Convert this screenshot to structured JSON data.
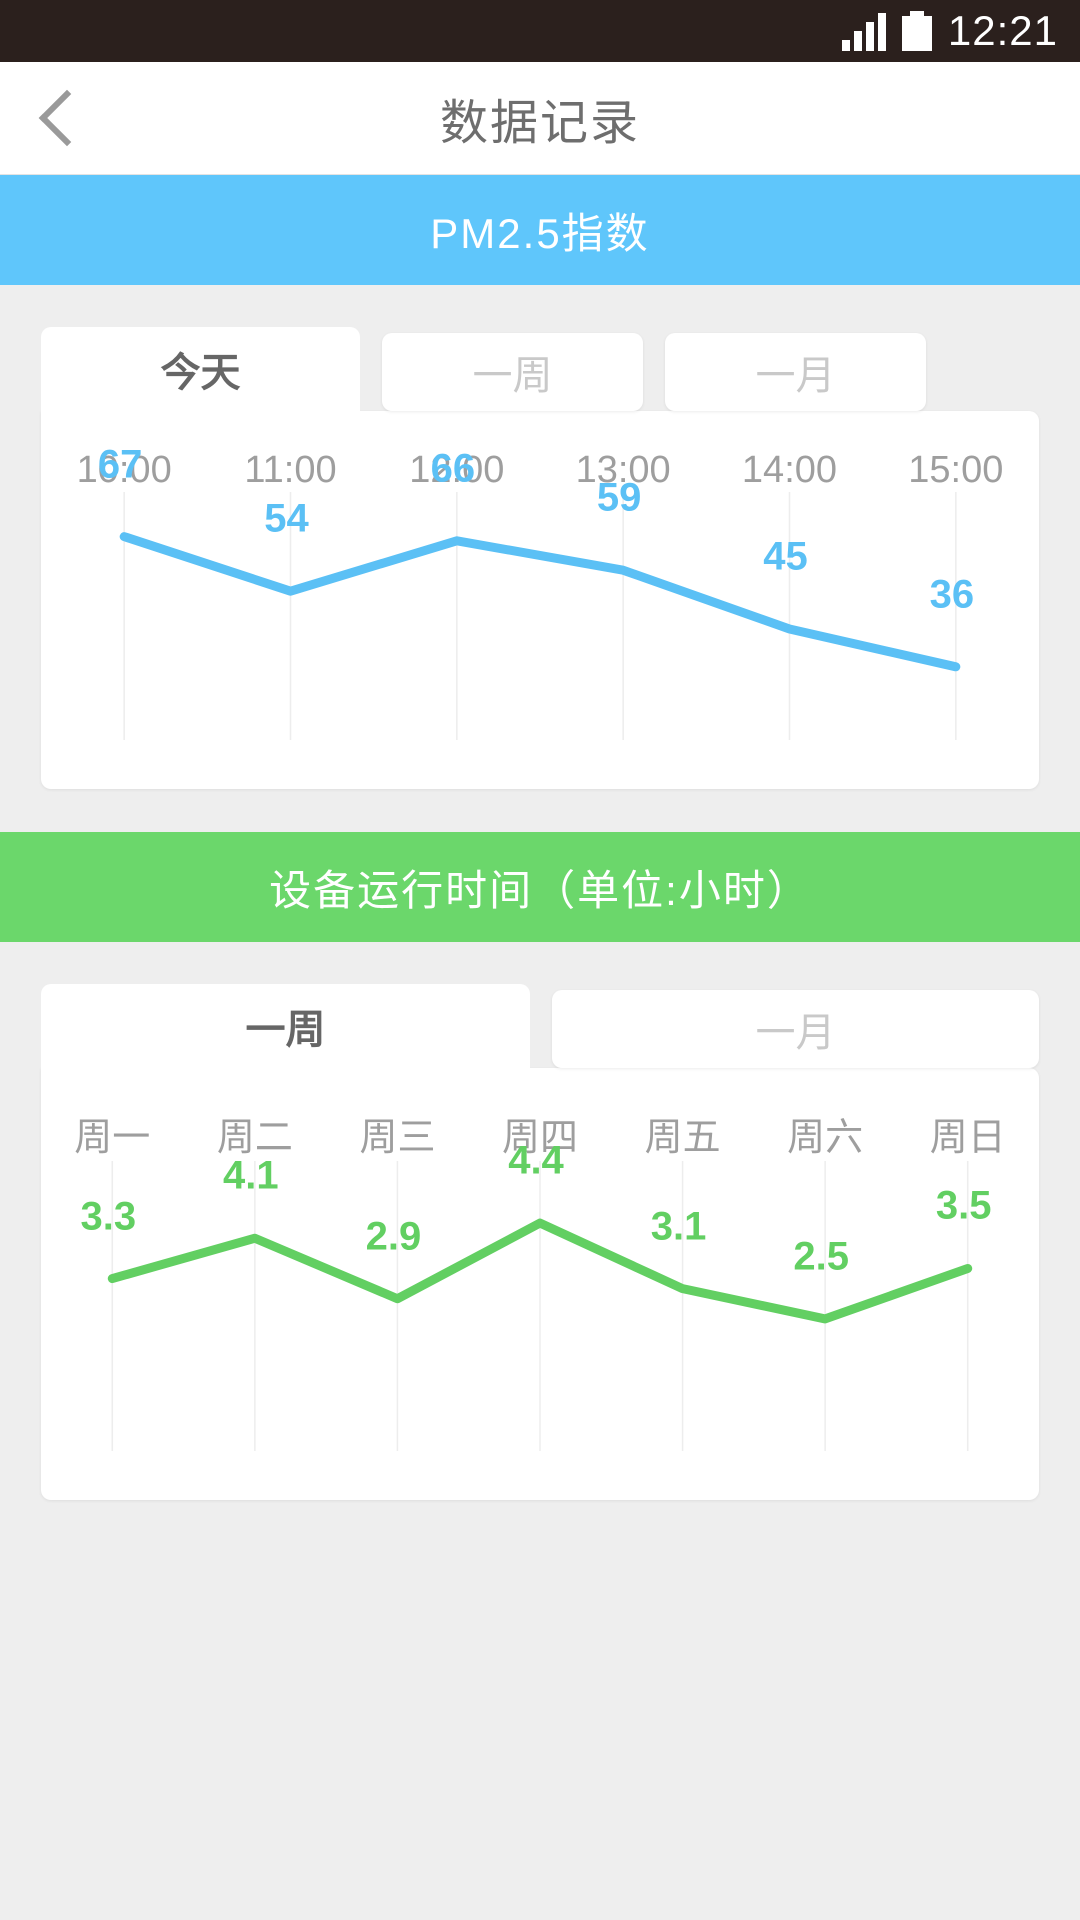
{
  "statusbar": {
    "time": "12:21",
    "signal_icon": "signal-bars-icon",
    "battery_icon": "battery-full-icon"
  },
  "titlebar": {
    "back_icon": "back-chevron-icon",
    "title": "数据记录"
  },
  "sections": [
    {
      "band_label": "PM2.5指数",
      "band_color": "#5fc6fb",
      "tabs": [
        {
          "label": "今天",
          "active": true
        },
        {
          "label": "一周",
          "active": false
        },
        {
          "label": "一月",
          "active": false
        }
      ]
    },
    {
      "band_label": "设备运行时间（单位:小时）",
      "band_color": "#6bd76b",
      "tabs": [
        {
          "label": "一周",
          "active": true
        },
        {
          "label": "一月",
          "active": false
        }
      ]
    }
  ],
  "chart_data": [
    {
      "type": "line",
      "title": "PM2.5指数",
      "xlabel": "",
      "ylabel": "",
      "grid": true,
      "legend": "none",
      "series_color": "#5bc0f5",
      "categories": [
        "10:00",
        "11:00",
        "12:00",
        "13:00",
        "14:00",
        "15:00"
      ],
      "values": [
        67,
        54,
        66,
        59,
        45,
        36
      ],
      "ylim": [
        30,
        70
      ]
    },
    {
      "type": "line",
      "title": "设备运行时间（单位:小时）",
      "xlabel": "",
      "ylabel": "小时",
      "grid": true,
      "legend": "none",
      "series_color": "#62cf62",
      "categories": [
        "周一",
        "周二",
        "周三",
        "周四",
        "周五",
        "周六",
        "周日"
      ],
      "values": [
        3.3,
        4.1,
        2.9,
        4.4,
        3.1,
        2.5,
        3.5
      ],
      "ylim": [
        2.3,
        4.6
      ]
    }
  ]
}
